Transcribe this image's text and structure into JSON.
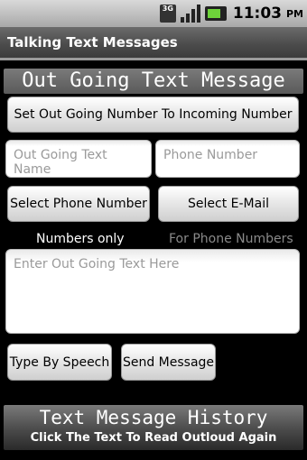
{
  "status": {
    "network": "3G",
    "time": "11:03",
    "ampm": "PM"
  },
  "app": {
    "title": "Talking Text Messages"
  },
  "outgoing": {
    "header": "Out Going Text Message",
    "set_number_button": "Set Out Going Number To Incoming Number",
    "name_placeholder": "Out Going Text Name",
    "phone_placeholder": "Phone Number",
    "select_phone_button": "Select Phone Number",
    "select_email_button": "Select E-Mail",
    "numbers_only_label": "Numbers only",
    "for_phone_label": "For Phone Numbers",
    "message_placeholder": "Enter Out Going Text Here",
    "type_by_speech_button": "Type By Speech",
    "send_message_button": "Send Message"
  },
  "history": {
    "header": "Text Message History",
    "subtitle": "Click The Text To Read Outloud Again"
  }
}
